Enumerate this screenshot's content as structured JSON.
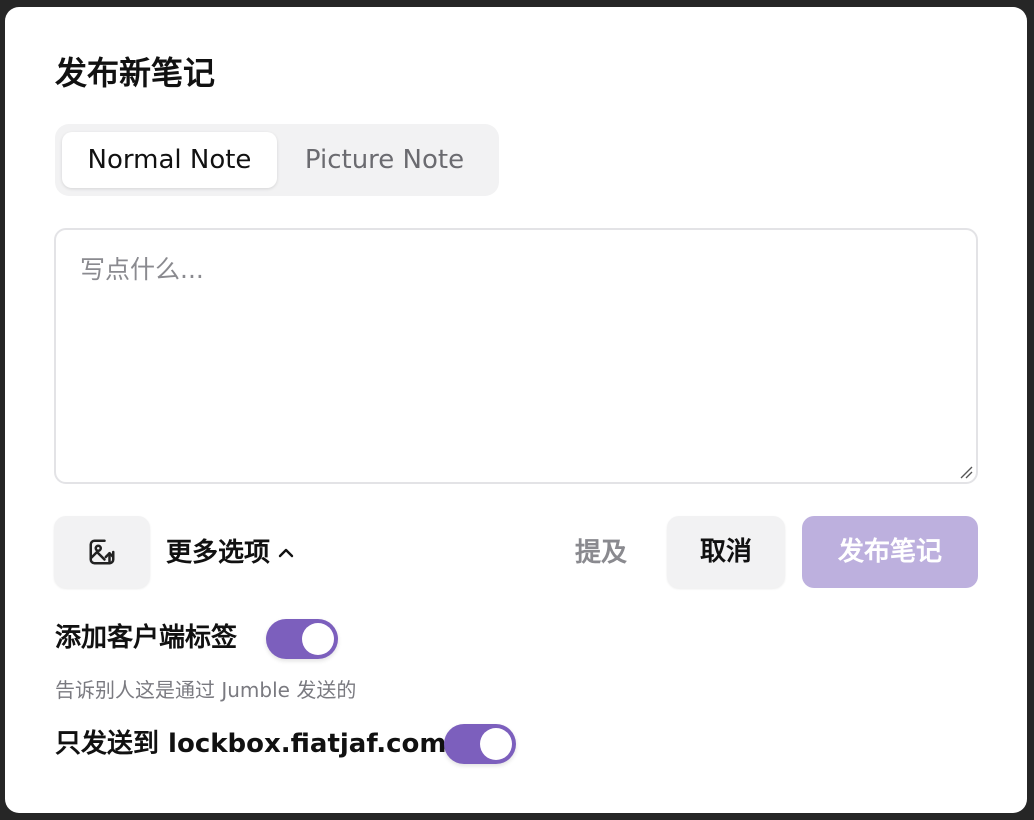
{
  "dialog": {
    "title": "发布新笔记",
    "tabs": [
      {
        "label": "Normal Note",
        "active": true
      },
      {
        "label": "Picture Note",
        "active": false
      }
    ],
    "editor": {
      "placeholder": "写点什么...",
      "value": ""
    },
    "toolbar": {
      "image_icon": "image-upload-icon",
      "more_options_label": "更多选项",
      "more_options_icon": "chevron-up-icon",
      "mention_label": "提及",
      "cancel_label": "取消",
      "publish_label": "发布笔记"
    },
    "settings": {
      "client_tag": {
        "label": "添加客户端标签",
        "description": "告诉别人这是通过 Jumble 发送的",
        "enabled": true
      },
      "relay_only": {
        "label": "只发送到 lockbox.fiatjaf.com",
        "enabled": true
      }
    }
  },
  "colors": {
    "accent": "#7c5fbd",
    "publish_disabled": "#bdb0de",
    "backdrop": "#262626"
  }
}
